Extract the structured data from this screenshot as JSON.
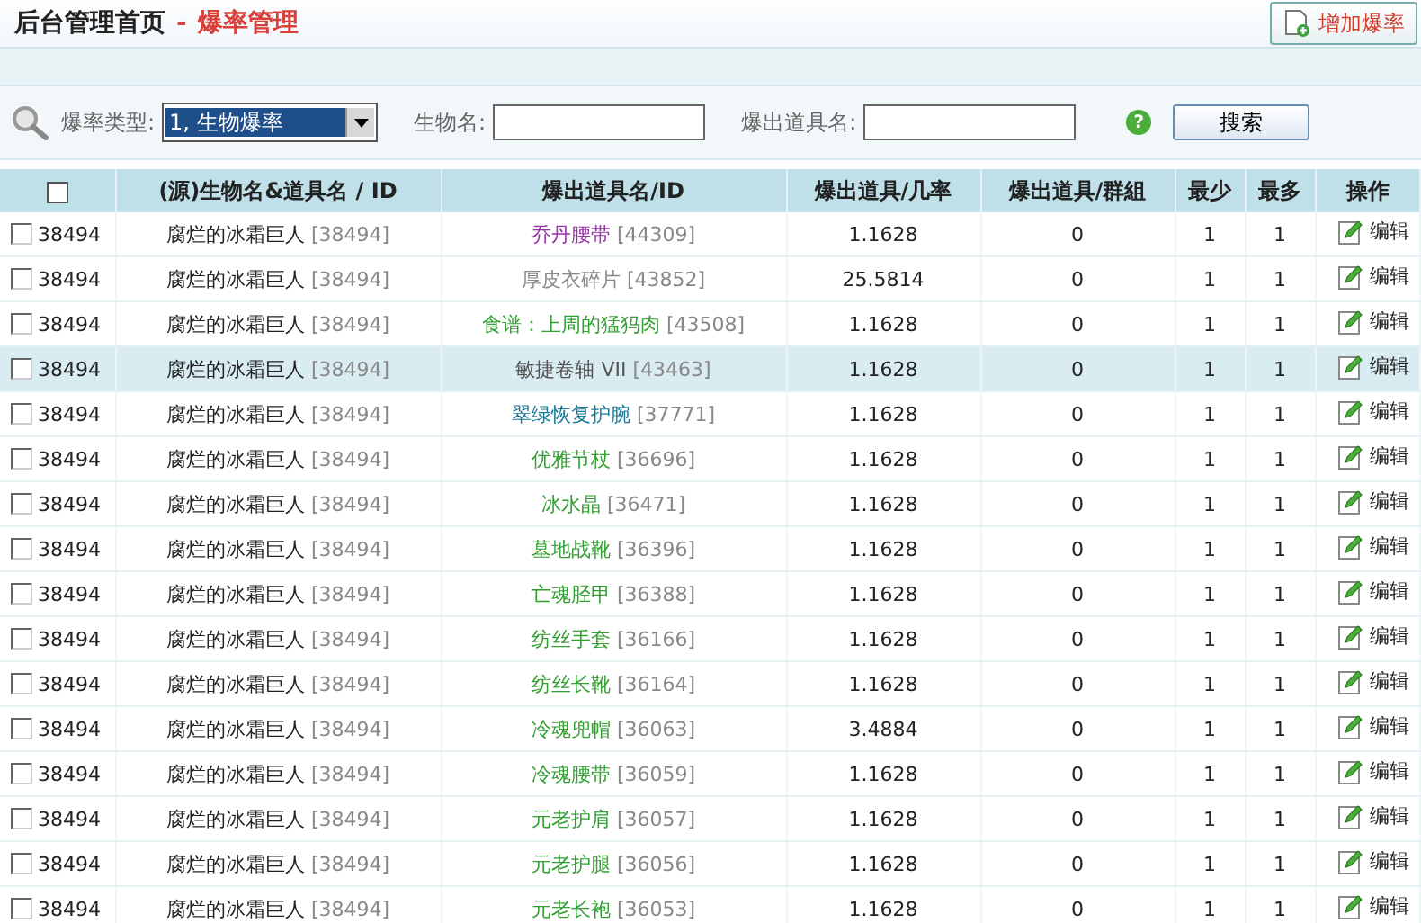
{
  "header": {
    "title": "后台管理首页",
    "separator": "-",
    "section": "爆率管理",
    "add_button": "增加爆率"
  },
  "filters": {
    "type_label": "爆率类型:",
    "type_value": "1, 生物爆率",
    "name_label": "生物名:",
    "item_label": "爆出道具名:",
    "help": "?",
    "search_button": "搜索"
  },
  "table": {
    "select_all_checked": false,
    "columns": [
      "(源)生物名&道具名 / ID",
      "爆出道具名/ID",
      "爆出道具/几率",
      "爆出道具/群組",
      "最少",
      "最多",
      "操作"
    ],
    "rows": [
      {
        "checked": false,
        "selected": false,
        "id": "38494",
        "source_name": "腐烂的冰霜巨人",
        "source_id": "[38494]",
        "item_name": "乔丹腰带",
        "item_id": "[44309]",
        "color": "#9933aa",
        "rate": "1.1628",
        "group": "0",
        "min": "1",
        "max": "1",
        "action": "编辑"
      },
      {
        "checked": false,
        "selected": false,
        "id": "38494",
        "source_name": "腐烂的冰霜巨人",
        "source_id": "[38494]",
        "item_name": "厚皮衣碎片",
        "item_id": "[43852]",
        "color": "#888888",
        "rate": "25.5814",
        "group": "0",
        "min": "1",
        "max": "1",
        "action": "编辑"
      },
      {
        "checked": false,
        "selected": false,
        "id": "38494",
        "source_name": "腐烂的冰霜巨人",
        "source_id": "[38494]",
        "item_name": "食谱：上周的猛犸肉",
        "item_id": "[43508]",
        "color": "#33a033",
        "rate": "1.1628",
        "group": "0",
        "min": "1",
        "max": "1",
        "action": "编辑"
      },
      {
        "checked": false,
        "selected": true,
        "id": "38494",
        "source_name": "腐烂的冰霜巨人",
        "source_id": "[38494]",
        "item_name": "敏捷卷轴 VII",
        "item_id": "[43463]",
        "color": "#555555",
        "rate": "1.1628",
        "group": "0",
        "min": "1",
        "max": "1",
        "action": "编辑"
      },
      {
        "checked": false,
        "selected": false,
        "id": "38494",
        "source_name": "腐烂的冰霜巨人",
        "source_id": "[38494]",
        "item_name": "翠绿恢复护腕",
        "item_id": "[37771]",
        "color": "#1a7a99",
        "rate": "1.1628",
        "group": "0",
        "min": "1",
        "max": "1",
        "action": "编辑"
      },
      {
        "checked": false,
        "selected": false,
        "id": "38494",
        "source_name": "腐烂的冰霜巨人",
        "source_id": "[38494]",
        "item_name": "优雅节杖",
        "item_id": "[36696]",
        "color": "#33a033",
        "rate": "1.1628",
        "group": "0",
        "min": "1",
        "max": "1",
        "action": "编辑"
      },
      {
        "checked": false,
        "selected": false,
        "id": "38494",
        "source_name": "腐烂的冰霜巨人",
        "source_id": "[38494]",
        "item_name": "冰水晶",
        "item_id": "[36471]",
        "color": "#33a033",
        "rate": "1.1628",
        "group": "0",
        "min": "1",
        "max": "1",
        "action": "编辑"
      },
      {
        "checked": false,
        "selected": false,
        "id": "38494",
        "source_name": "腐烂的冰霜巨人",
        "source_id": "[38494]",
        "item_name": "墓地战靴",
        "item_id": "[36396]",
        "color": "#33a033",
        "rate": "1.1628",
        "group": "0",
        "min": "1",
        "max": "1",
        "action": "编辑"
      },
      {
        "checked": false,
        "selected": false,
        "id": "38494",
        "source_name": "腐烂的冰霜巨人",
        "source_id": "[38494]",
        "item_name": "亡魂胫甲",
        "item_id": "[36388]",
        "color": "#33a033",
        "rate": "1.1628",
        "group": "0",
        "min": "1",
        "max": "1",
        "action": "编辑"
      },
      {
        "checked": false,
        "selected": false,
        "id": "38494",
        "source_name": "腐烂的冰霜巨人",
        "source_id": "[38494]",
        "item_name": "纺丝手套",
        "item_id": "[36166]",
        "color": "#33a033",
        "rate": "1.1628",
        "group": "0",
        "min": "1",
        "max": "1",
        "action": "编辑"
      },
      {
        "checked": false,
        "selected": false,
        "id": "38494",
        "source_name": "腐烂的冰霜巨人",
        "source_id": "[38494]",
        "item_name": "纺丝长靴",
        "item_id": "[36164]",
        "color": "#33a033",
        "rate": "1.1628",
        "group": "0",
        "min": "1",
        "max": "1",
        "action": "编辑"
      },
      {
        "checked": false,
        "selected": false,
        "id": "38494",
        "source_name": "腐烂的冰霜巨人",
        "source_id": "[38494]",
        "item_name": "冷魂兜帽",
        "item_id": "[36063]",
        "color": "#33a033",
        "rate": "3.4884",
        "group": "0",
        "min": "1",
        "max": "1",
        "action": "编辑"
      },
      {
        "checked": false,
        "selected": false,
        "id": "38494",
        "source_name": "腐烂的冰霜巨人",
        "source_id": "[38494]",
        "item_name": "冷魂腰带",
        "item_id": "[36059]",
        "color": "#33a033",
        "rate": "1.1628",
        "group": "0",
        "min": "1",
        "max": "1",
        "action": "编辑"
      },
      {
        "checked": false,
        "selected": false,
        "id": "38494",
        "source_name": "腐烂的冰霜巨人",
        "source_id": "[38494]",
        "item_name": "元老护肩",
        "item_id": "[36057]",
        "color": "#33a033",
        "rate": "1.1628",
        "group": "0",
        "min": "1",
        "max": "1",
        "action": "编辑"
      },
      {
        "checked": false,
        "selected": false,
        "id": "38494",
        "source_name": "腐烂的冰霜巨人",
        "source_id": "[38494]",
        "item_name": "元老护腿",
        "item_id": "[36056]",
        "color": "#33a033",
        "rate": "1.1628",
        "group": "0",
        "min": "1",
        "max": "1",
        "action": "编辑"
      },
      {
        "checked": false,
        "selected": false,
        "id": "38494",
        "source_name": "腐烂的冰霜巨人",
        "source_id": "[38494]",
        "item_name": "元老长袍",
        "item_id": "[36053]",
        "color": "#33a033",
        "rate": "1.1628",
        "group": "0",
        "min": "1",
        "max": "1",
        "action": "编辑"
      }
    ]
  }
}
